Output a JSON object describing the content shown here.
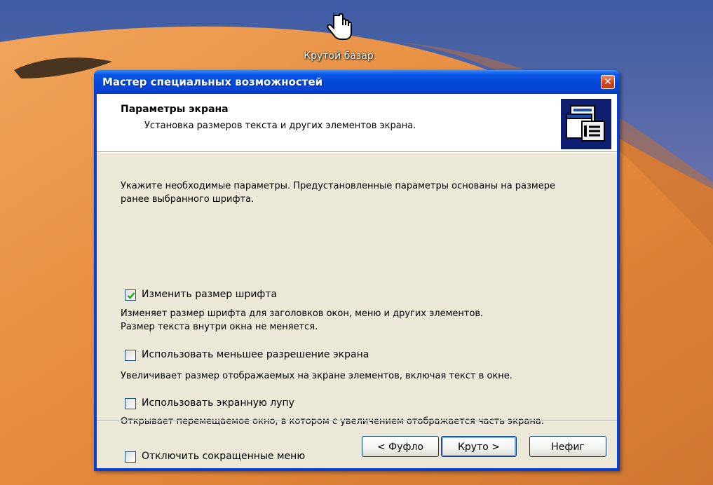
{
  "desktop": {
    "icon_label": "Крутой базар",
    "colors": {
      "sky": "#4f6bb0",
      "dune": "#e5893d",
      "shadow": "#8a4a1f"
    }
  },
  "window": {
    "title": "Мастер специальных возможностей",
    "close_glyph": "✕",
    "colors": {
      "titlebar": "#0a58e8",
      "client": "#ece9d8"
    }
  },
  "header": {
    "title": "Параметры экрана",
    "subtitle": "Установка размеров текста и других элементов экрана.",
    "icon": "display-settings-icon"
  },
  "intro": "Укажите необходимые параметры. Предустановленные параметры основаны на размере ранее выбранного шрифта.",
  "options": [
    {
      "label": "Изменить размер шрифта",
      "checked": true,
      "desc1": "Изменяет размер шрифта для заголовков окон, меню и других элементов.",
      "desc2": "Размер текста внутри окна не меняется."
    },
    {
      "label": "Использовать меньшее разрешение экрана",
      "checked": false,
      "desc1": "Увеличивает размер отображаемых на экране элементов, включая текст в окне."
    },
    {
      "label": "Использовать экранную лупу",
      "checked": false,
      "desc1": "Открывает перемещаемое окно, в котором с увеличением отображается часть экрана."
    },
    {
      "label": "Отключить сокращенные меню",
      "checked": false
    }
  ],
  "buttons": {
    "back": "< Фуфло",
    "next": "Круто >",
    "cancel": "Нефиг"
  }
}
